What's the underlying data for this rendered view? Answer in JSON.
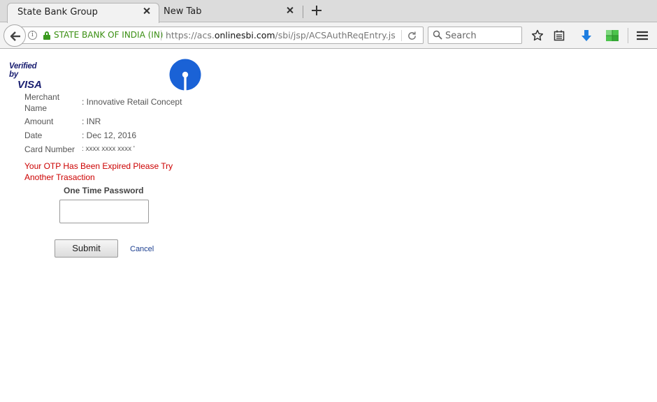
{
  "browser": {
    "tabs": [
      {
        "title": "State Bank Group",
        "active": true
      },
      {
        "title": "New Tab",
        "active": false
      }
    ],
    "identity": "STATE BANK OF INDIA (IN)",
    "url": {
      "prefix": "https://acs.",
      "host": "onlinesbi.com",
      "path": "/sbi/jsp/ACSAuthReqEntry.js"
    },
    "search_placeholder": "Search",
    "colors": {
      "identity_green": "#3a8f12",
      "download_blue": "#1e7ee0",
      "ext_green": "#4cc44c"
    },
    "toolbar_icons": [
      "bookmark-star-icon",
      "reading-list-icon",
      "download-arrow-icon",
      "extension-icon",
      "hamburger-menu-icon"
    ]
  },
  "page": {
    "logos": {
      "visa_line1": "Verified by",
      "visa_line2": "VISA",
      "sbi_color": "#1a62d6"
    },
    "details": [
      {
        "label": "Merchant Name",
        "value": ": Innovative Retail Concept"
      },
      {
        "label": "Amount",
        "value": ": INR"
      },
      {
        "label": "Date",
        "value": ": Dec 12, 2016"
      },
      {
        "label": "Card Number",
        "value": ": xxxx xxxx xxxx '"
      }
    ],
    "error": "Your OTP Has Been Expired Please Try Another Trasaction",
    "otp_label": "One Time Password",
    "otp_value": "",
    "submit_label": "Submit",
    "cancel_label": "Cancel",
    "colors": {
      "error_red": "#cc0000",
      "link_blue": "#1a3d8f"
    }
  }
}
